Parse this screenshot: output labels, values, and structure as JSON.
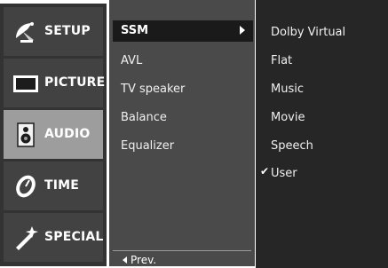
{
  "categories": [
    {
      "label": "SETUP",
      "icon": "satellite-dish-icon",
      "selected": false
    },
    {
      "label": "PICTURE",
      "icon": "tv-screen-icon",
      "selected": false
    },
    {
      "label": "AUDIO",
      "icon": "speaker-icon",
      "selected": true
    },
    {
      "label": "TIME",
      "icon": "clock-icon",
      "selected": false
    },
    {
      "label": "SPECIAL",
      "icon": "magic-wand-icon",
      "selected": false
    }
  ],
  "submenu": {
    "items": [
      {
        "label": "SSM",
        "selected": true,
        "has_submenu": true
      },
      {
        "label": "AVL"
      },
      {
        "label": "TV speaker"
      },
      {
        "label": "Balance"
      },
      {
        "label": "Equalizer"
      }
    ],
    "prev_label": "Prev."
  },
  "options": {
    "items": [
      {
        "label": "Dolby Virtual"
      },
      {
        "label": "Flat"
      },
      {
        "label": "Music"
      },
      {
        "label": "Movie"
      },
      {
        "label": "Speech"
      },
      {
        "label": "User",
        "checked": true
      }
    ],
    "check_glyph": "✔"
  },
  "colors": {
    "panel_dark": "#262626",
    "submenu_bg": "#4a4a4a",
    "category_selected": "#9d9d9d"
  }
}
